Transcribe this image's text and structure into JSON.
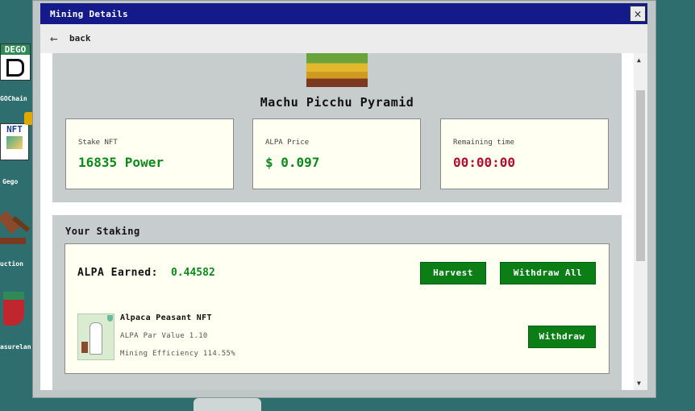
{
  "window": {
    "title": "Mining Details",
    "close_glyph": "✕",
    "back_label": "back"
  },
  "desktop": {
    "icons": [
      {
        "label": "GOChain",
        "icon": "dego-logo-icon"
      },
      {
        "label": "Gego",
        "icon": "nft-card-icon"
      },
      {
        "label": "uction",
        "icon": "auction-hammer-icon"
      },
      {
        "label": "asurelan",
        "icon": "treasure-stocking-icon"
      }
    ],
    "dego_logo_text": "DEGO",
    "nft_logo_text": "NFT"
  },
  "pool": {
    "name": "Machu Picchu Pyramid",
    "stats": [
      {
        "label": "Stake NFT",
        "value": "16835 Power",
        "color": "#0d8a1c"
      },
      {
        "label": "ALPA Price",
        "value": "$ 0.097",
        "color": "#0d8a1c"
      },
      {
        "label": "Remaining time",
        "value": "00:00:00",
        "color": "#b01030"
      }
    ]
  },
  "staking": {
    "title": "Your Staking",
    "earned_label": "ALPA Earned:",
    "earned_value": "0.44582",
    "harvest_label": "Harvest",
    "withdraw_all_label": "Withdraw All",
    "nft": {
      "name": "Alpaca Peasant NFT",
      "par_value": "ALPA Par Value 1.10",
      "efficiency": "Mining Efficiency 114.55%",
      "withdraw_label": "Withdraw"
    }
  },
  "colors": {
    "title_bar": "#141a8a",
    "button_green": "#0b7f16",
    "desktop_bg": "#2f6e6e"
  }
}
